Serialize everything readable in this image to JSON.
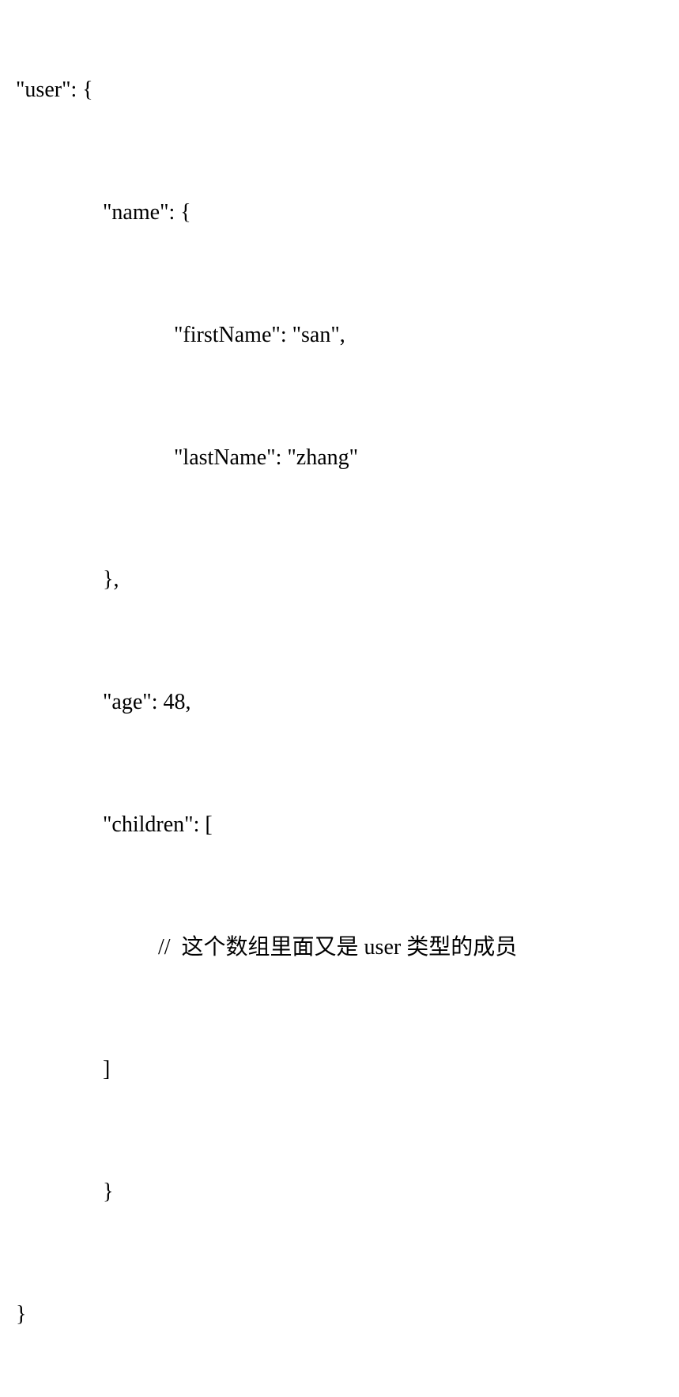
{
  "code": {
    "line1": "\"user\": {",
    "line2": "\"name\": {",
    "line3": "\"firstName\": \"san\",",
    "line4": "\"lastName\": \"zhang\"",
    "line5": "},",
    "line6": "\"age\": 48,",
    "line7": "\"children\": [",
    "line8": "//  这个数组里面又是 user 类型的成员",
    "line9": "]",
    "line10": "}",
    "line11": "}"
  }
}
